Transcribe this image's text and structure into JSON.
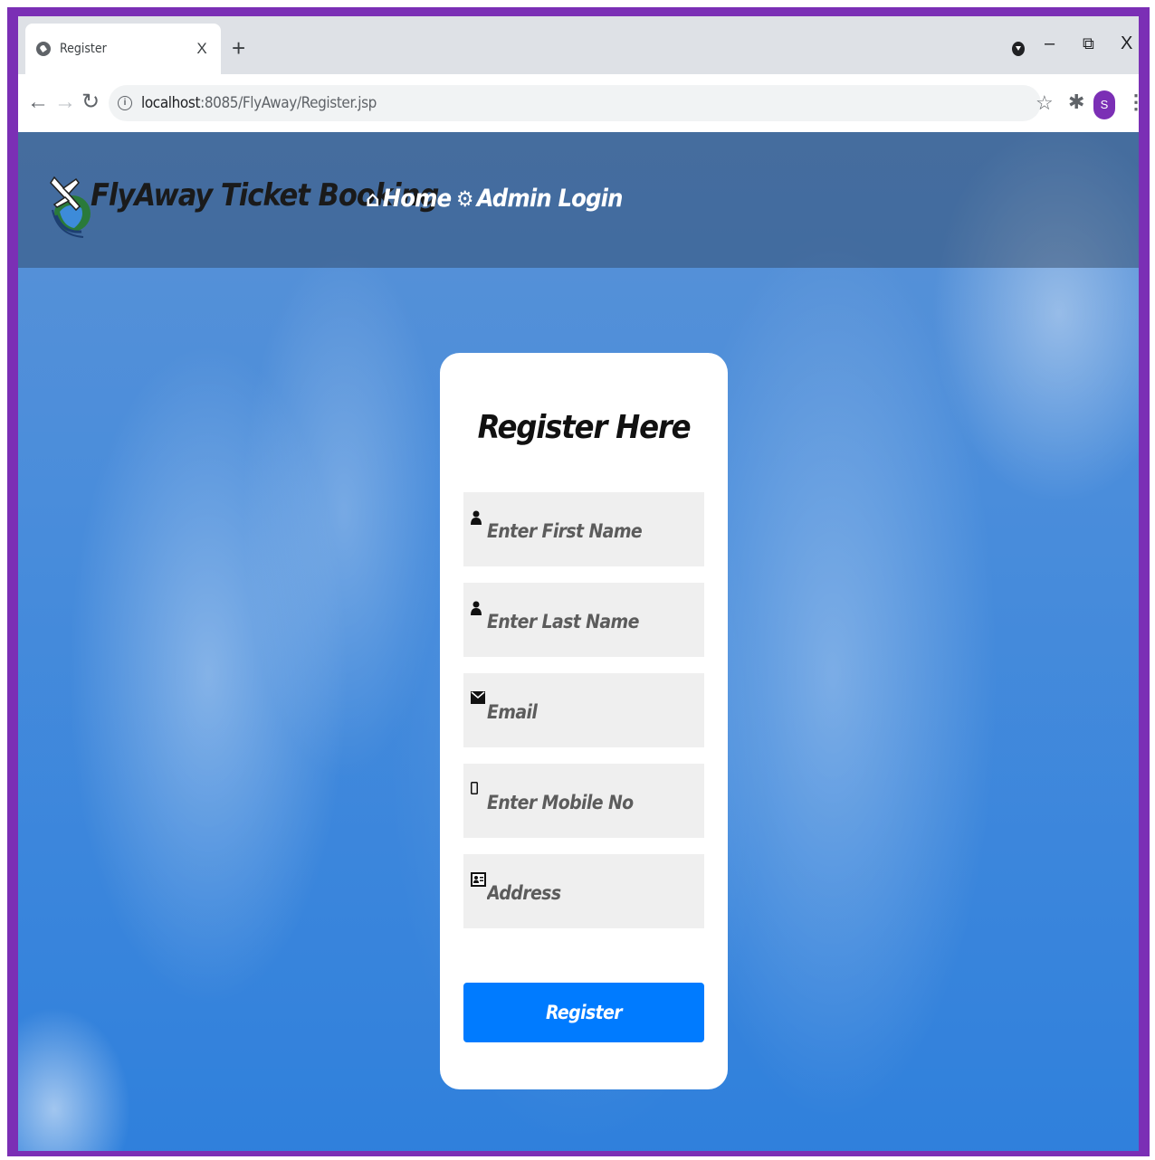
{
  "browser": {
    "tab_title": "Register",
    "tab_close": "X",
    "new_tab": "+",
    "url_host": "localhost",
    "url_path": ":8085/FlyAway/Register.jsp",
    "avatar_letter": "S",
    "window_controls": {
      "minimize": "–",
      "restore": "⧉",
      "close": "X"
    },
    "icons": [
      "back-arrow-icon",
      "forward-arrow-icon",
      "reload-icon",
      "info-icon",
      "star-icon",
      "extensions-icon",
      "menu-icon"
    ]
  },
  "site": {
    "brand": "FlyAway Ticket Booking",
    "nav": [
      {
        "icon": "home-icon",
        "label": "Home"
      },
      {
        "icon": "gear-icon",
        "label": "Admin Login"
      }
    ]
  },
  "form": {
    "title": "Register Here",
    "fields": [
      {
        "icon": "user-icon",
        "placeholder": "Enter First Name",
        "value": ""
      },
      {
        "icon": "user-icon",
        "placeholder": "Enter Last Name",
        "value": ""
      },
      {
        "icon": "envelope-icon",
        "placeholder": "Email",
        "value": ""
      },
      {
        "icon": "mobile-icon",
        "placeholder": "Enter Mobile No",
        "value": ""
      },
      {
        "icon": "address-card-icon",
        "placeholder": "Address",
        "value": ""
      }
    ],
    "submit_label": "Register"
  },
  "colors": {
    "frame": "#7b2fb5",
    "button": "#007bff",
    "sky": "#3f86db"
  }
}
